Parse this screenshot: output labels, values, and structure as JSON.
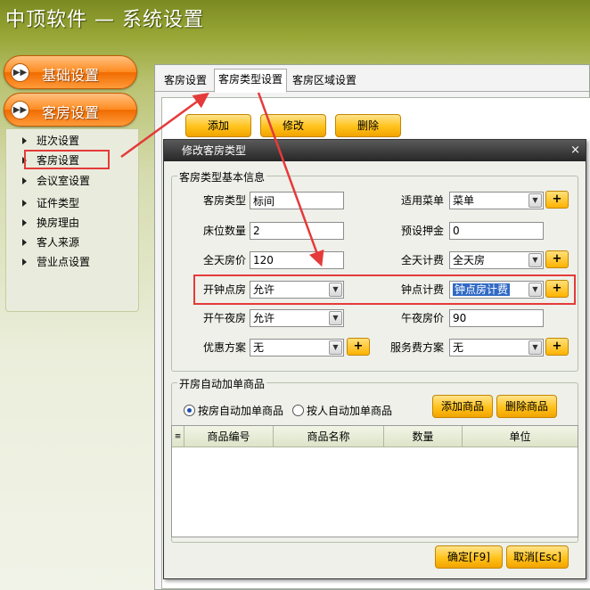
{
  "app": {
    "title": "中顶软件 — 系统设置"
  },
  "sidebar": {
    "categories": [
      {
        "label": "基础设置",
        "icon": "double-chevron-right-icon"
      },
      {
        "label": "客房设置",
        "icon": "double-chevron-right-icon"
      }
    ],
    "items": [
      {
        "label": "班次设置"
      },
      {
        "label": "客房设置",
        "selected": true
      },
      {
        "label": "会议室设置"
      },
      {
        "label": "证件类型"
      },
      {
        "label": "换房理由"
      },
      {
        "label": "客人来源"
      },
      {
        "label": "营业点设置"
      }
    ]
  },
  "tabs": [
    {
      "label": "客房设置"
    },
    {
      "label": "客房类型设置",
      "active": true
    },
    {
      "label": "客房区域设置"
    }
  ],
  "toolbar": {
    "add": "添加",
    "edit": "修改",
    "delete": "删除"
  },
  "dialog": {
    "title": "修改客房类型",
    "close": "×",
    "basic_group": "客房类型基本信息",
    "fields": {
      "room_type": {
        "label": "客房类型",
        "value": "标间"
      },
      "menu": {
        "label": "适用菜单",
        "value": "菜单"
      },
      "bed_count": {
        "label": "床位数量",
        "value": "2"
      },
      "deposit": {
        "label": "预设押金",
        "value": "0"
      },
      "day_price": {
        "label": "全天房价",
        "value": "120"
      },
      "day_billing": {
        "label": "全天计费",
        "value": "全天房"
      },
      "hourly": {
        "label": "开钟点房",
        "value": "允许"
      },
      "hourly_billing": {
        "label": "钟点计费",
        "value": "钟点房计费"
      },
      "midnight": {
        "label": "开午夜房",
        "value": "允许"
      },
      "midnight_price": {
        "label": "午夜房价",
        "value": "90"
      },
      "discount": {
        "label": "优惠方案",
        "value": "无"
      },
      "service_fee": {
        "label": "服务费方案",
        "value": "无"
      }
    },
    "auto_group": "开房自动加单商品",
    "radio_auto_room": "按房自动加单商品",
    "radio_auto_person": "按人自动加单商品",
    "add_goods": "添加商品",
    "delete_goods": "删除商品",
    "grid_columns": [
      "商品编号",
      "商品名称",
      "数量",
      "单位"
    ],
    "ok": "确定[F9]",
    "cancel": "取消[Esc]"
  },
  "colors": {
    "accent_orange": "#ff8a1f",
    "highlight_red": "#e53a3a",
    "button_yellow": "#ffc21a"
  }
}
